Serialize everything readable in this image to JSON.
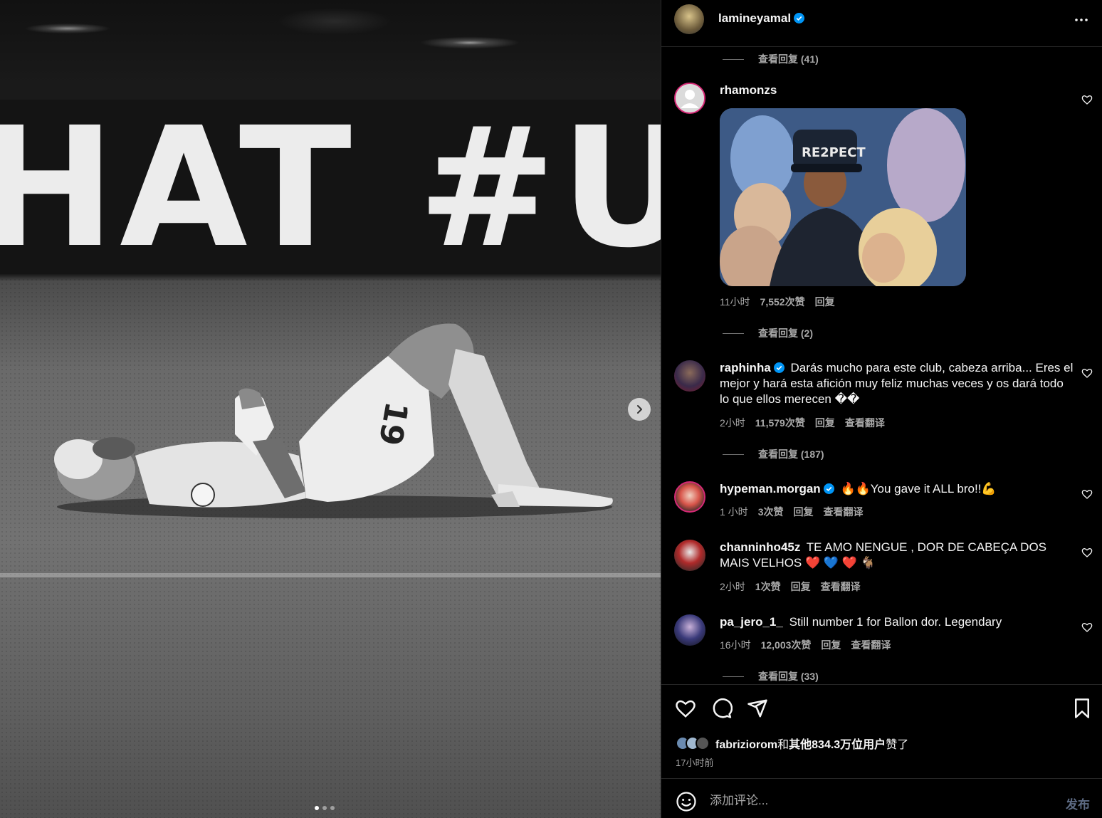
{
  "post": {
    "author": "lamineyamal",
    "banner_text": "HAT #U",
    "carousel": {
      "count": 3,
      "active": 0
    }
  },
  "comments": {
    "view_replies_top": "查看回复 (41)",
    "items": [
      {
        "user": "rhamonzs",
        "verified": false,
        "text": "",
        "gif_caption": "RE2PECT",
        "time": "11小时",
        "likes": "7,552次赞",
        "reply": "回复",
        "translate": "",
        "view_replies": "查看回复 (2)"
      },
      {
        "user": "raphinha",
        "verified": true,
        "text": "Darás mucho para este club, cabeza arriba... Eres el mejor y hará esta afición muy feliz muchas veces y os dará todo lo que ellos merecen ��",
        "time": "2小时",
        "likes": "11,579次赞",
        "reply": "回复",
        "translate": "查看翻译",
        "view_replies": "查看回复 (187)"
      },
      {
        "user": "hypeman.morgan",
        "verified": true,
        "text": "🔥🔥You gave it ALL bro!!💪",
        "time": "1 小时",
        "likes": "3次赞",
        "reply": "回复",
        "translate": "查看翻译"
      },
      {
        "user": "channinho45z",
        "verified": false,
        "text": "TE AMO NENGUE , DOR DE CABEÇA DOS MAIS VELHOS ❤️ 💙 ❤️ 🐐",
        "time": "2小时",
        "likes": "1次赞",
        "reply": "回复",
        "translate": "查看翻译"
      },
      {
        "user": "pa_jero_1_",
        "verified": false,
        "text": "Still number 1 for Ballon dor. Legendary",
        "time": "16小时",
        "likes": "12,003次赞",
        "reply": "回复",
        "translate": "查看翻译",
        "view_replies": "查看回复 (33)"
      }
    ]
  },
  "actions": {
    "liked_by_user": "fabriziorom",
    "liked_by_conj": "和",
    "liked_by_others": "其他834.3万位用户",
    "liked_by_suffix": "赞了",
    "post_time": "17小时前"
  },
  "compose": {
    "placeholder": "添加评论...",
    "post_label": "发布"
  },
  "colors": {
    "background": "#000000",
    "text_primary": "#f5f5f5",
    "text_secondary": "#a8a8a8",
    "verified_blue": "#0095f6",
    "post_disabled": "#5d6b84"
  }
}
